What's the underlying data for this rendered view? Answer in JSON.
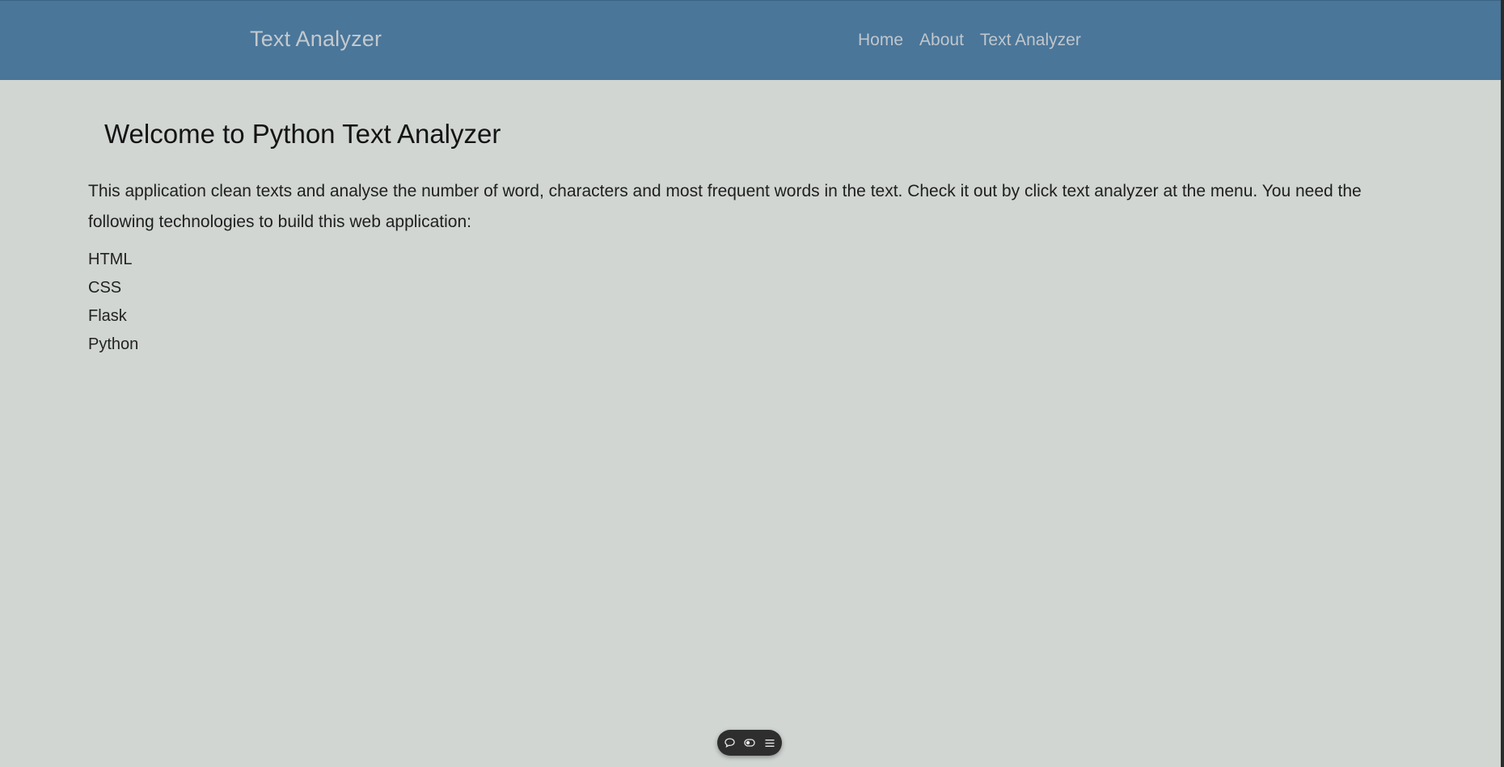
{
  "navbar": {
    "brand": "Text Analyzer",
    "links": [
      "Home",
      "About",
      "Text Analyzer"
    ],
    "background_color": "#4a7699"
  },
  "main": {
    "title": "Welcome to Python Text Analyzer",
    "intro": "This application clean texts and analyse the number of word, characters and most frequent words in the text. Check it out by click text analyzer at the menu. You need the following technologies to build this web application:",
    "technologies": [
      "HTML",
      "CSS",
      "Flask",
      "Python"
    ],
    "background_color": "#d1d6d2"
  },
  "floating_toolbar": {
    "icons": [
      "comment-icon",
      "toggle-icon",
      "menu-icon"
    ]
  }
}
